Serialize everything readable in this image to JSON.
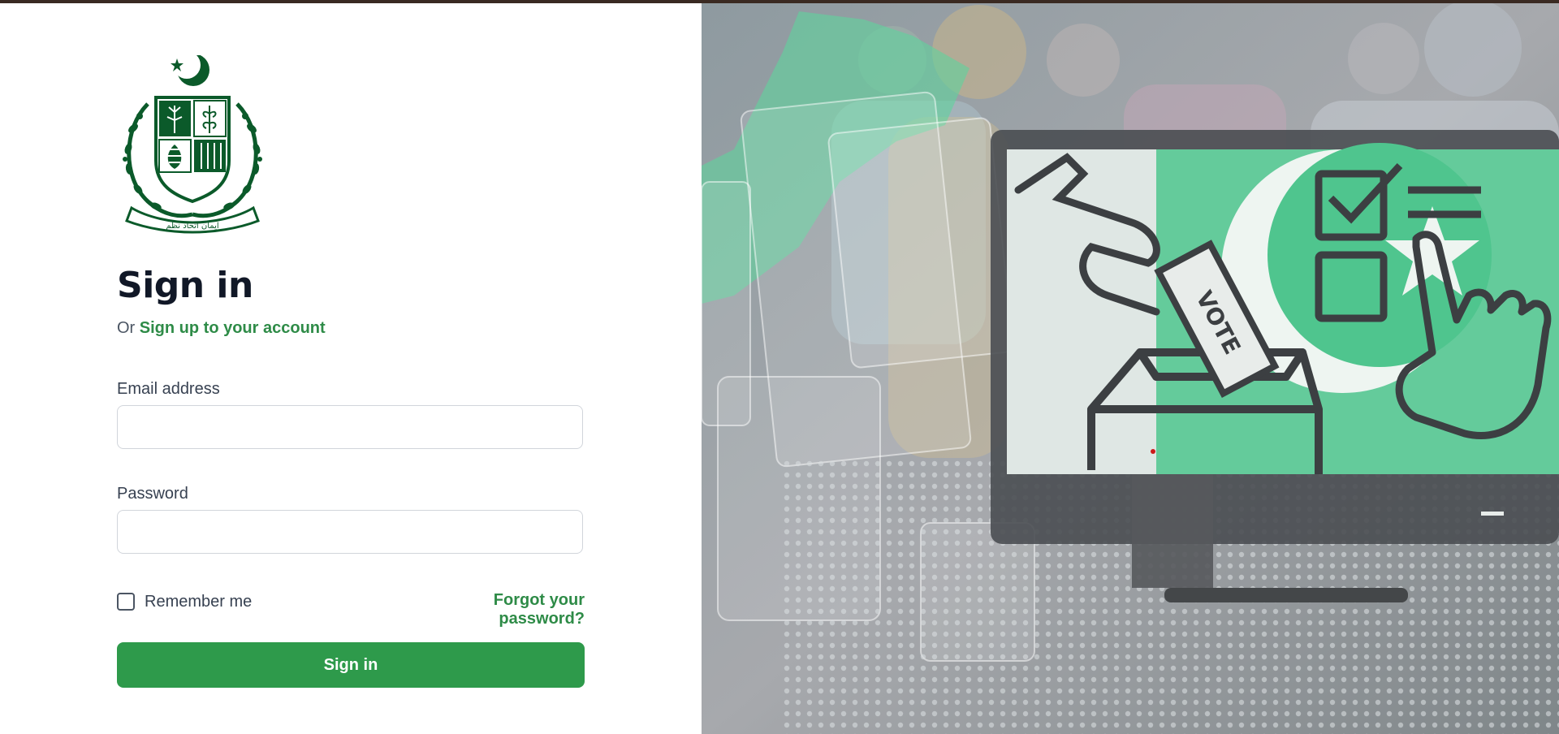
{
  "auth": {
    "title": "Sign in",
    "subtitle_prefix": "Or",
    "signup_link": "Sign up to your account",
    "email_label": "Email address",
    "email_value": "",
    "password_label": "Password",
    "password_value": "",
    "remember_label": "Remember me",
    "remember_checked": false,
    "forgot_link": "Forgot your password?",
    "submit_label": "Sign in"
  },
  "hero": {
    "ballot_text": "VOTE"
  },
  "emblem": {
    "motto_urdu": "ایمان اتحاد نظم"
  },
  "colors": {
    "accent": "#2e9a4b",
    "link": "#2e8b47",
    "emblem_green": "#0b5a2a",
    "title": "#111827"
  },
  "icons": {
    "emblem": "state-emblem-icon",
    "hero": "voting-hero-illustration"
  }
}
